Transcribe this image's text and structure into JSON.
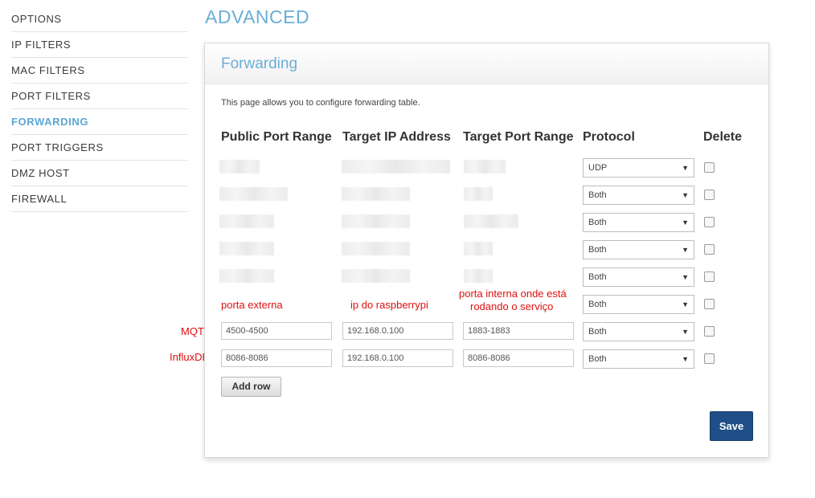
{
  "sidebar": {
    "items": [
      {
        "label": "OPTIONS"
      },
      {
        "label": "IP FILTERS"
      },
      {
        "label": "MAC FILTERS"
      },
      {
        "label": "PORT FILTERS"
      },
      {
        "label": "FORWARDING",
        "active": true
      },
      {
        "label": "PORT TRIGGERS"
      },
      {
        "label": "DMZ HOST"
      },
      {
        "label": "FIREWALL"
      }
    ]
  },
  "page": {
    "title": "ADVANCED"
  },
  "panel": {
    "title": "Forwarding",
    "description": "This page allows you to configure forwarding table.",
    "columns": {
      "public_port": "Public Port Range",
      "target_ip": "Target IP Address",
      "target_port": "Target Port Range",
      "protocol": "Protocol",
      "delete": "Delete"
    },
    "rows": [
      {
        "protocol": "UDP",
        "redacted": true
      },
      {
        "protocol": "Both",
        "redacted": true
      },
      {
        "protocol": "Both",
        "redacted": true
      },
      {
        "protocol": "Both",
        "redacted": true
      },
      {
        "protocol": "Both",
        "redacted": true
      },
      {
        "protocol": "Both",
        "redacted": true
      },
      {
        "label": "MQTT",
        "public_port": "4500-4500",
        "target_ip": "192.168.0.100",
        "target_port": "1883-1883",
        "protocol": "Both"
      },
      {
        "label": "InfluxDB",
        "public_port": "8086-8086",
        "target_ip": "192.168.0.100",
        "target_port": "8086-8086",
        "protocol": "Both"
      }
    ],
    "annotations": {
      "external_port": "porta externa",
      "raspberry_ip": "ip do raspberrypi",
      "internal_port_line1": "porta interna onde está",
      "internal_port_line2": "rodando o serviço"
    },
    "add_row_label": "Add row",
    "save_label": "Save"
  },
  "colors": {
    "accent": "#6aaed6",
    "save_button": "#1f4f86",
    "annotation": "#e01010"
  }
}
